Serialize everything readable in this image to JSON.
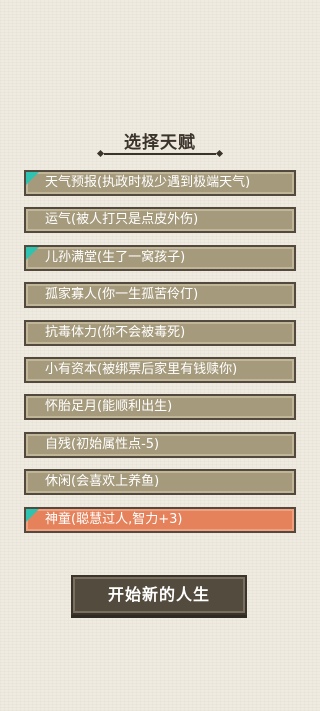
{
  "header": {
    "title": "选择天赋"
  },
  "talents": [
    {
      "label": "天气预报(执政时极少遇到极端天气)",
      "badge": true,
      "selected": false
    },
    {
      "label": "运气(被人打只是点皮外伤)",
      "badge": false,
      "selected": false
    },
    {
      "label": "儿孙满堂(生了一窝孩子)",
      "badge": true,
      "selected": false
    },
    {
      "label": "孤家寡人(你一生孤苦伶仃)",
      "badge": false,
      "selected": false
    },
    {
      "label": "抗毒体力(你不会被毒死)",
      "badge": false,
      "selected": false
    },
    {
      "label": "小有资本(被绑票后家里有钱赎你)",
      "badge": false,
      "selected": false
    },
    {
      "label": "怀胎足月(能顺利出生)",
      "badge": false,
      "selected": false
    },
    {
      "label": "自残(初始属性点-5)",
      "badge": false,
      "selected": false
    },
    {
      "label": "休闲(会喜欢上养鱼)",
      "badge": false,
      "selected": false
    },
    {
      "label": "神童(聪慧过人,智力+3)",
      "badge": true,
      "selected": true
    }
  ],
  "actions": {
    "start_label": "开始新的人生"
  },
  "colors": {
    "background": "#efebe1",
    "item": "#a59a7c",
    "item_border": "#524a3e",
    "item_selected": "#e5825b",
    "badge": "#2ec3b0",
    "button": "#544b3f"
  },
  "icons": {
    "badge": "corner-triangle-icon"
  }
}
